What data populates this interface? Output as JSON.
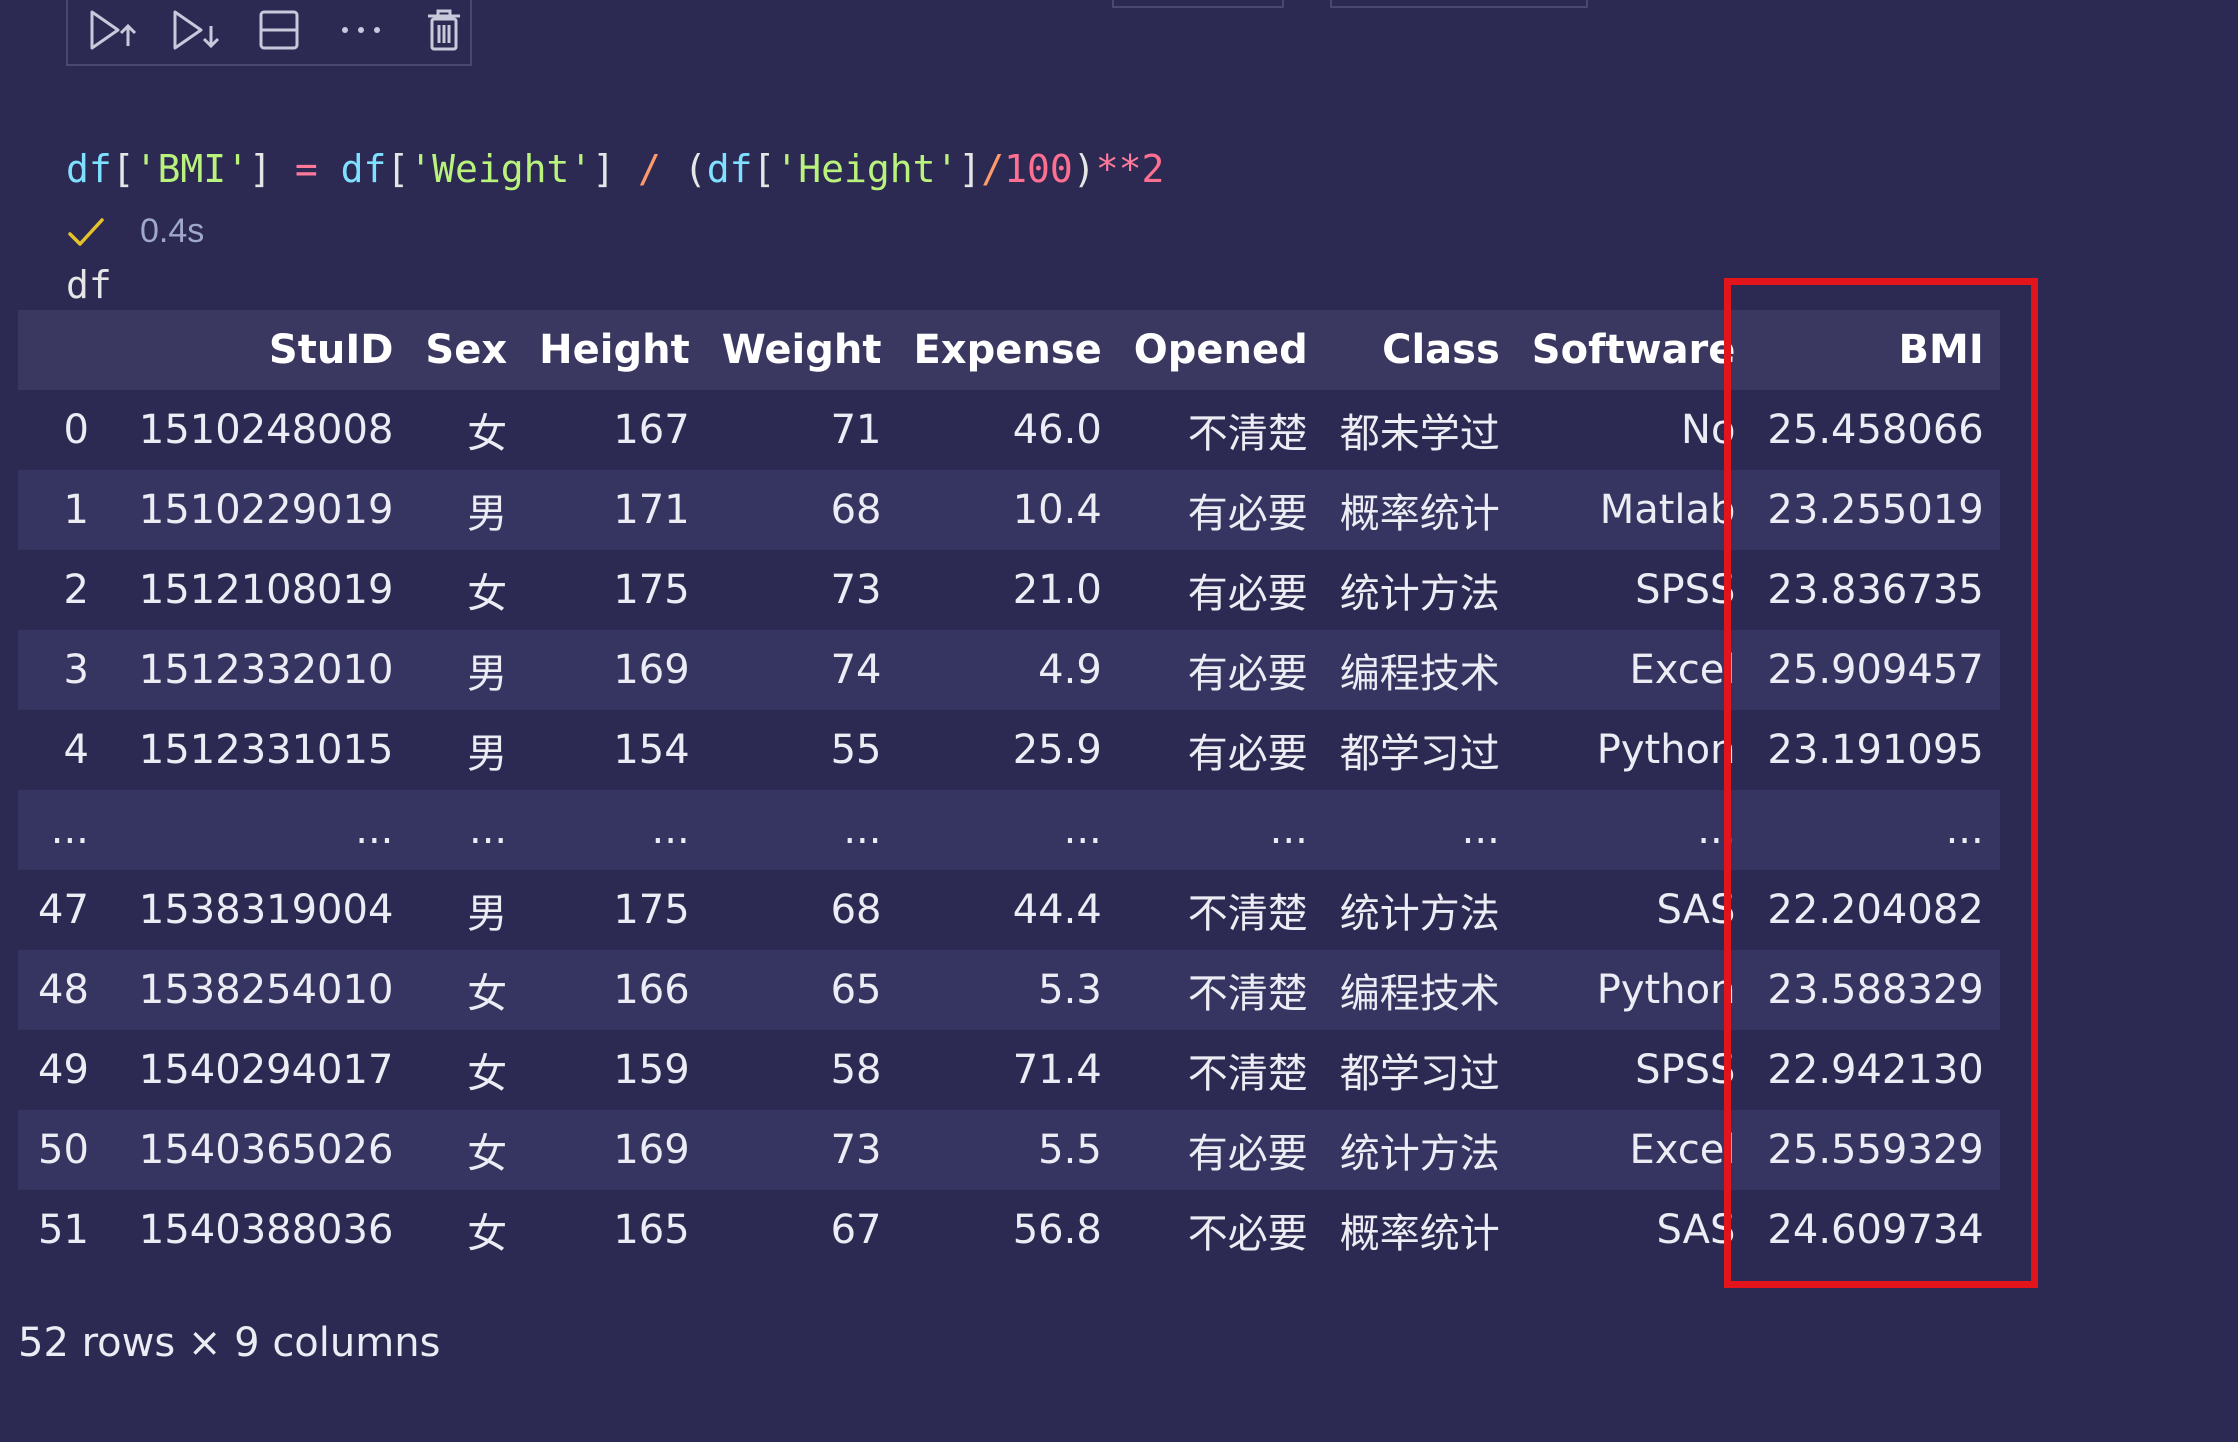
{
  "cell_toolbar": {
    "icons": [
      "run-above-icon",
      "run-below-icon",
      "split-cell-icon",
      "more-icon",
      "delete-icon"
    ]
  },
  "code": {
    "line1": {
      "t1": "df",
      "t2": "[",
      "t3": "'BMI'",
      "t4": "] ",
      "t5": "=",
      "t6": " df",
      "t7": "[",
      "t8": "'Weight'",
      "t9": "] ",
      "t10": "/",
      "t11": " (",
      "t12": "df",
      "t13": "[",
      "t14": "'Height'",
      "t15": "]",
      "t16": "/",
      "t17": "100",
      "t18": ")",
      "t19": "**",
      "t20": "2"
    },
    "line2": "df"
  },
  "exec": {
    "status_icon": "checkmark-icon",
    "time": "0.4s"
  },
  "table": {
    "columns": [
      "",
      "StuID",
      "Sex",
      "Height",
      "Weight",
      "Expense",
      "Opened",
      "Class",
      "Software",
      "BMI"
    ],
    "rows": [
      [
        "0",
        "1510248008",
        "女",
        "167",
        "71",
        "46.0",
        "不清楚",
        "都未学过",
        "No",
        "25.458066"
      ],
      [
        "1",
        "1510229019",
        "男",
        "171",
        "68",
        "10.4",
        "有必要",
        "概率统计",
        "Matlab",
        "23.255019"
      ],
      [
        "2",
        "1512108019",
        "女",
        "175",
        "73",
        "21.0",
        "有必要",
        "统计方法",
        "SPSS",
        "23.836735"
      ],
      [
        "3",
        "1512332010",
        "男",
        "169",
        "74",
        "4.9",
        "有必要",
        "编程技术",
        "Excel",
        "25.909457"
      ],
      [
        "4",
        "1512331015",
        "男",
        "154",
        "55",
        "25.9",
        "有必要",
        "都学习过",
        "Python",
        "23.191095"
      ],
      [
        "...",
        "...",
        "...",
        "...",
        "...",
        "...",
        "...",
        "...",
        "...",
        "..."
      ],
      [
        "47",
        "1538319004",
        "男",
        "175",
        "68",
        "44.4",
        "不清楚",
        "统计方法",
        "SAS",
        "22.204082"
      ],
      [
        "48",
        "1538254010",
        "女",
        "166",
        "65",
        "5.3",
        "不清楚",
        "编程技术",
        "Python",
        "23.588329"
      ],
      [
        "49",
        "1540294017",
        "女",
        "159",
        "58",
        "71.4",
        "不清楚",
        "都学习过",
        "SPSS",
        "22.942130"
      ],
      [
        "50",
        "1540365026",
        "女",
        "169",
        "73",
        "5.5",
        "有必要",
        "统计方法",
        "Excel",
        "25.559329"
      ],
      [
        "51",
        "1540388036",
        "女",
        "165",
        "67",
        "56.8",
        "不必要",
        "概率统计",
        "SAS",
        "24.609734"
      ]
    ],
    "shape_text": "52 rows × 9 columns"
  },
  "colors": {
    "background": "#2c2a52",
    "header_row": "#3a3860",
    "stripe_row": "#363460",
    "highlight_border": "#e3141c",
    "check": "#e6c229"
  }
}
